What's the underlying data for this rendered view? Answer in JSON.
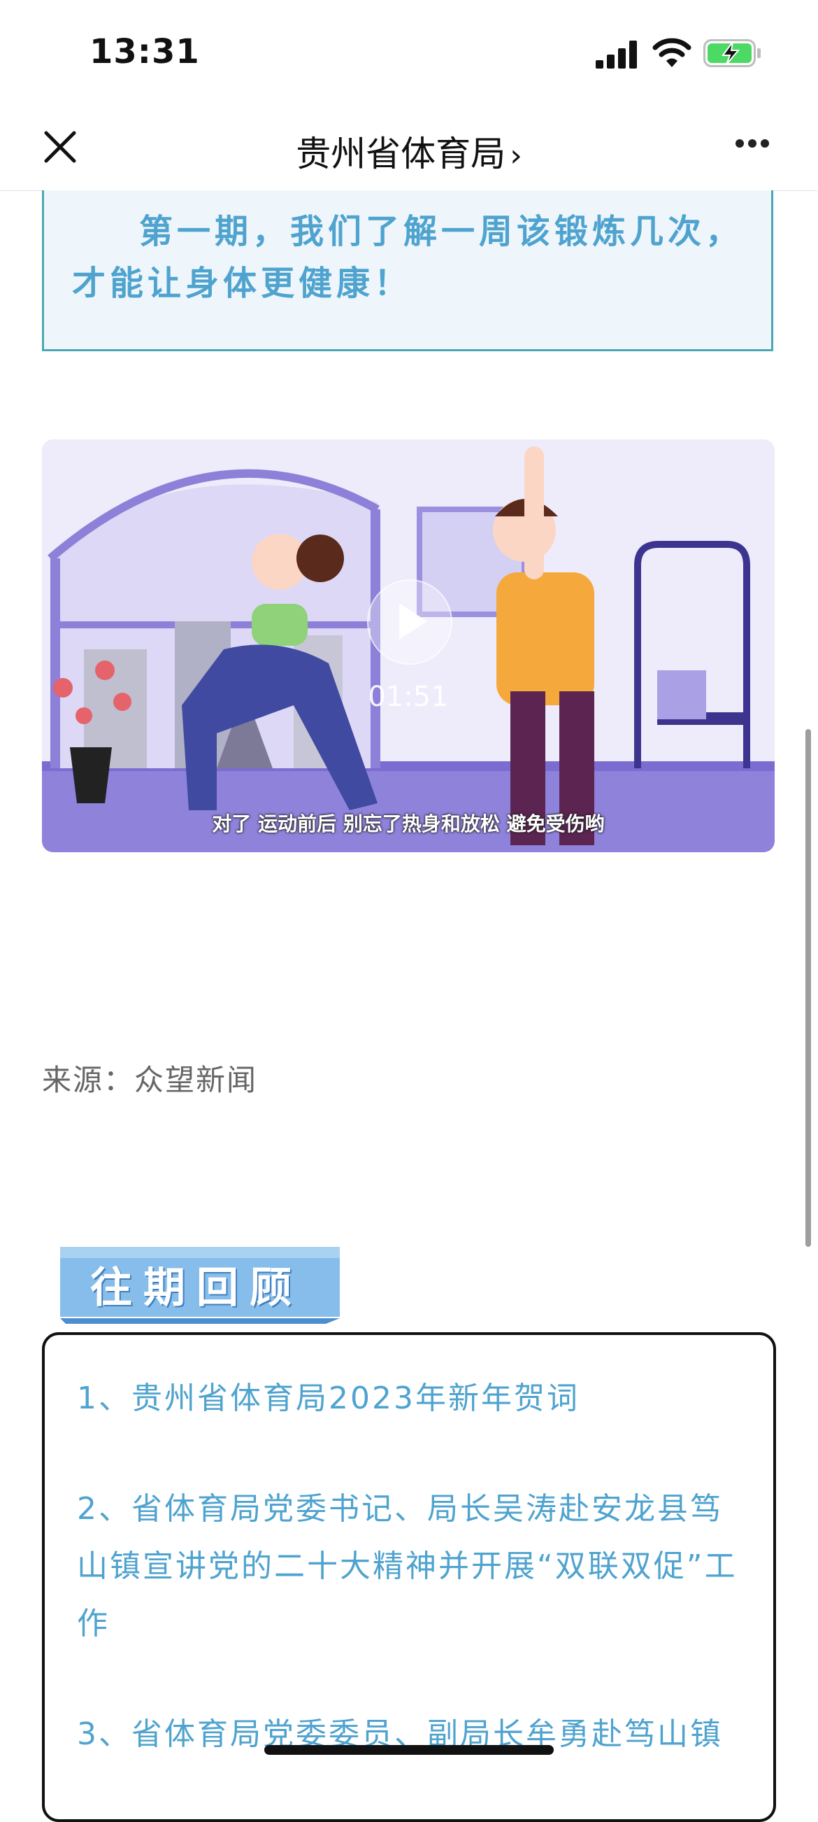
{
  "status_bar": {
    "time": "13:31",
    "signal_icon": "cellular-signal-icon",
    "wifi_icon": "wifi-icon",
    "battery_icon": "battery-charging-icon",
    "battery_color": "#4cd964"
  },
  "nav": {
    "close_icon": "close-icon",
    "title": "贵州省体育局",
    "chevron": "›",
    "more_icon": "more-dots-icon"
  },
  "intro": {
    "text": "第一期，我们了解一周该锻炼几次，才能让身体更健康！",
    "text_color": "#4fa3cf",
    "border_color": "#4aa8b5"
  },
  "video": {
    "play_icon": "play-icon",
    "duration": "01:51",
    "subtitle": "对了 运动前后 别忘了热身和放松 避免受伤哟"
  },
  "source": {
    "text": "来源：众望新闻"
  },
  "review": {
    "title": "往期回顾",
    "banner_color": "#7fb8e6",
    "items": [
      "1、贵州省体育局2023年新年贺词",
      "2、省体育局党委书记、局长吴涛赴安龙县笃山镇宣讲党的二十大精神并开展“双联双促”工作",
      "3、省体育局党委委员、副局长牟勇赴笃山镇"
    ]
  }
}
